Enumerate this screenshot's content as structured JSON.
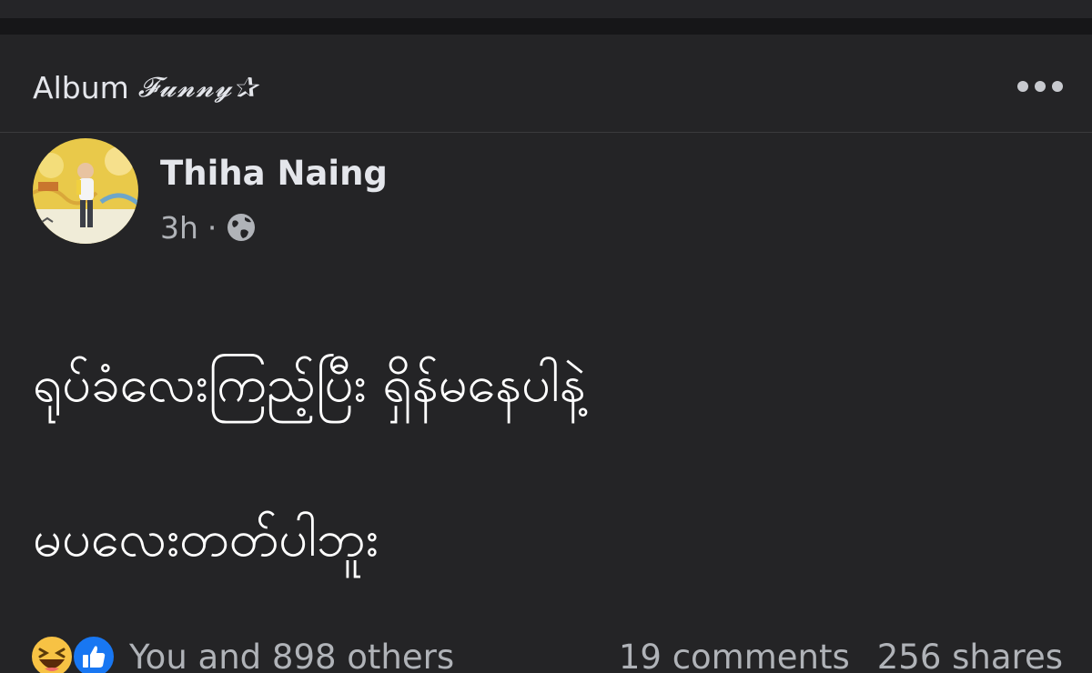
{
  "album": {
    "prefix": "Album",
    "name": "𝓕𝓾𝓷𝓷𝔂✰"
  },
  "post": {
    "author": "Thiha Naing",
    "time": "3h",
    "separator": "·",
    "privacy_icon": "globe-icon",
    "body_lines": [
      "ရုပ်ခံလေးကြည့်ပြီး ရှိန်မနေပါနဲ့",
      "မပလေးတတ်ပါဘူး"
    ]
  },
  "footer": {
    "reactions": [
      "haha-icon",
      "like-icon"
    ],
    "reactions_text": "You and 898 others",
    "comments": "19 comments",
    "shares": "256 shares"
  },
  "colors": {
    "background": "#242426",
    "text_primary": "#e4e6eb",
    "text_secondary": "#b0b3b8",
    "like_blue": "#1877f2",
    "haha_yellow": "#f7c244"
  }
}
